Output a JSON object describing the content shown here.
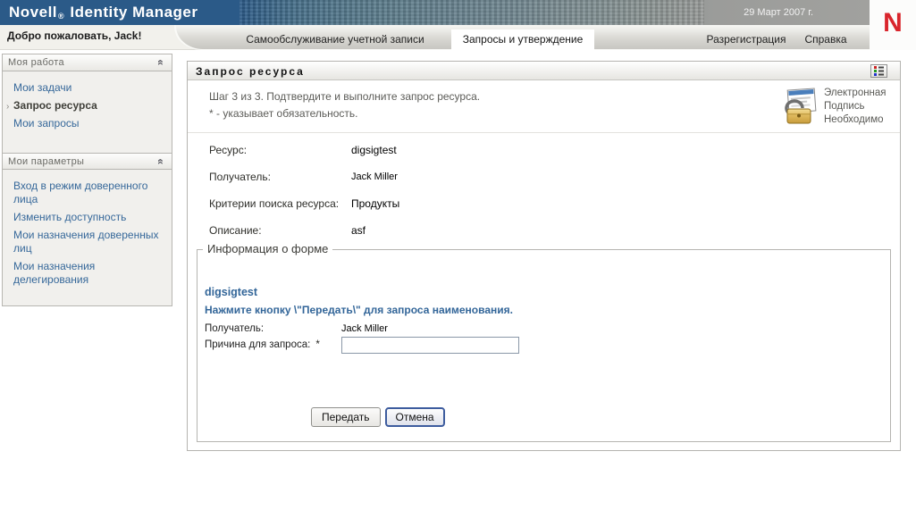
{
  "header": {
    "brand_name": "Novell",
    "brand_reg": "®",
    "brand_product": "Identity Manager",
    "date": "29 Март 2007 г.",
    "logo_letter": "N"
  },
  "welcome": {
    "text": "Добро пожаловать, Jack!"
  },
  "tabs": [
    {
      "label": "Самообслуживание учетной записи",
      "active": false
    },
    {
      "label": "Запросы и утверждение",
      "active": true
    },
    {
      "label": "Разрегистрация",
      "active": false
    },
    {
      "label": "Справка",
      "active": false
    }
  ],
  "sidebar": {
    "sections": [
      {
        "title": "Моя работа",
        "items": [
          {
            "label": "Мои задачи",
            "active": false
          },
          {
            "label": "Запрос ресурса",
            "active": true
          },
          {
            "label": "Мои запросы",
            "active": false
          }
        ]
      },
      {
        "title": "Мои параметры",
        "items": [
          {
            "label": "Вход в режим доверенного лица",
            "active": false
          },
          {
            "label": "Изменить доступность",
            "active": false
          },
          {
            "label": "Мои назначения доверенных лиц",
            "active": false
          },
          {
            "label": "Мои назначения делегирования",
            "active": false
          }
        ]
      }
    ]
  },
  "main": {
    "title": "Запрос ресурса",
    "step_line1": "Шаг 3 из 3. Подтвердите и выполните запрос ресурса.",
    "step_line2": "* - указывает обязательность.",
    "esign_line1": "Электронная",
    "esign_line2": "Подпись",
    "esign_line3": "Необходимо",
    "summary": [
      {
        "label": "Ресурс:",
        "value": "digsigtest"
      },
      {
        "label": "Получатель:",
        "value": "Jack Miller"
      },
      {
        "label": "Критерии поиска ресурса:",
        "value": "Продукты"
      },
      {
        "label": "Описание:",
        "value": "asf"
      }
    ],
    "form": {
      "legend": "Информация о форме",
      "resource_name": "digsigtest",
      "instruction": "Нажмите кнопку \\\"Передать\\\" для запроса наименования.",
      "recipient_label": "Получатель:",
      "recipient_value": "Jack Miller",
      "reason_label": "Причина для запроса:",
      "required_marker": "*",
      "reason_value": "",
      "submit_label": "Передать",
      "cancel_label": "Отмена"
    }
  },
  "icons": {
    "collapse": "double-chevron-up",
    "portlet_options": "color-grid",
    "esign": "document-with-padlock",
    "active_item_marker": "›"
  },
  "colors": {
    "header_blue": "#2b5a88",
    "logo_red": "#d9252c",
    "link_blue": "#36689a",
    "accent_text_blue": "#336699",
    "panel_border": "#b5b4b0"
  }
}
